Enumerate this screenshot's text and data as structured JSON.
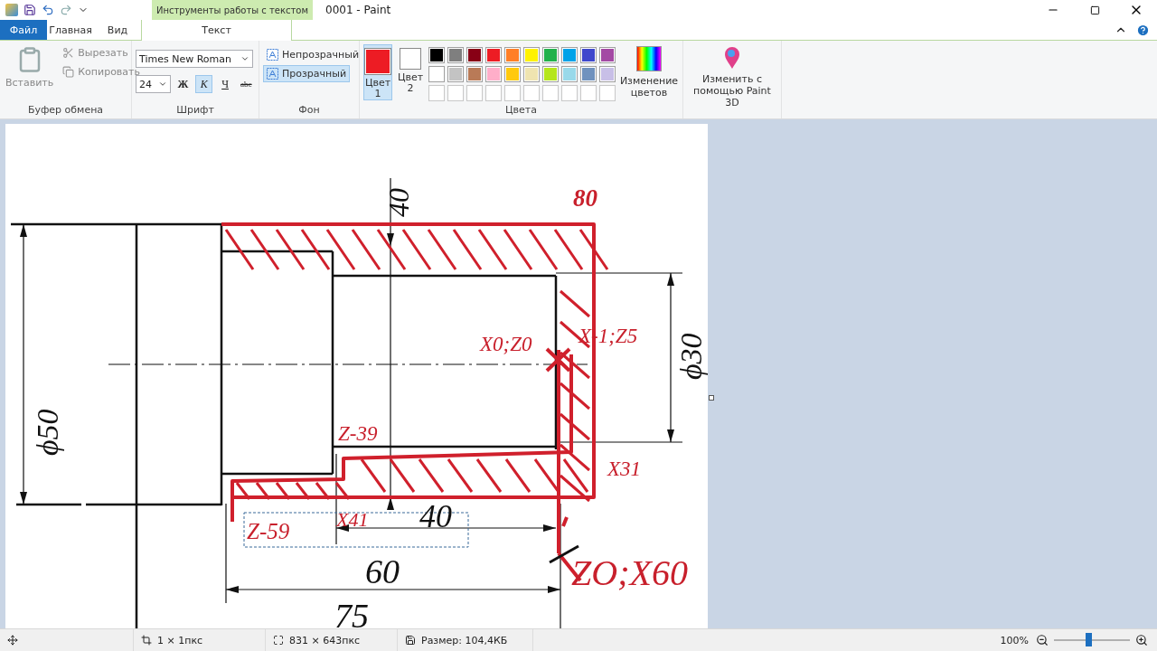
{
  "window": {
    "title": "0001 - Paint",
    "context_group": "Инструменты работы с текстом"
  },
  "tabs": [
    {
      "label": "Файл",
      "kind": "file",
      "selected": false
    },
    {
      "label": "Главная",
      "kind": "tab",
      "selected": false
    },
    {
      "label": "Вид",
      "kind": "tab",
      "selected": false
    },
    {
      "label": "Текст",
      "kind": "context",
      "selected": true
    }
  ],
  "clipboard": {
    "label": "Буфер обмена",
    "paste": {
      "label": "Вставить",
      "disabled": true
    },
    "items": [
      {
        "label": "Вырезать",
        "kind": "cut",
        "disabled": true
      },
      {
        "label": "Копировать",
        "kind": "copy",
        "disabled": true
      }
    ]
  },
  "font": {
    "label": "Шрифт",
    "family": "Times New Roman",
    "size": "24",
    "styles": [
      {
        "label": "Ж",
        "kind": "bold",
        "selected": false
      },
      {
        "label": "К",
        "kind": "italic",
        "selected": true
      },
      {
        "label": "Ч",
        "kind": "underline",
        "selected": false
      },
      {
        "label": "abc",
        "kind": "strike",
        "selected": false
      }
    ]
  },
  "background": {
    "label": "Фон",
    "options": [
      {
        "label": "Непрозрачный",
        "selected": false
      },
      {
        "label": "Прозрачный",
        "selected": true
      }
    ]
  },
  "colors": {
    "label": "Цвета",
    "slots": [
      {
        "label": "Цвет",
        "number": "1",
        "color": "#ed1c24",
        "selected": true
      },
      {
        "label": "Цвет",
        "number": "2",
        "color": "#ffffff",
        "selected": false
      }
    ],
    "palette": [
      {
        "color": "#000000"
      },
      {
        "color": "#7f7f7f"
      },
      {
        "color": "#880015"
      },
      {
        "color": "#ed1c24"
      },
      {
        "color": "#ff7f27"
      },
      {
        "color": "#fff200"
      },
      {
        "color": "#22b14c"
      },
      {
        "color": "#00a2e8"
      },
      {
        "color": "#3f48cc"
      },
      {
        "color": "#a349a4"
      },
      {
        "color": "#ffffff"
      },
      {
        "color": "#c3c3c3"
      },
      {
        "color": "#b97a57"
      },
      {
        "color": "#ffaec9"
      },
      {
        "color": "#ffc90e"
      },
      {
        "color": "#efe4b0"
      },
      {
        "color": "#b5e61d"
      },
      {
        "color": "#99d9ea"
      },
      {
        "color": "#7092be"
      },
      {
        "color": "#c8bfe7"
      }
    ],
    "edit": "Изменение цветов"
  },
  "paint3d": "Изменить с помощью Paint 3D",
  "canvas": {
    "labels": [
      {
        "text": "40",
        "color": "#111111"
      },
      {
        "text": "80",
        "color": "#c8202c"
      },
      {
        "text": "X0;Z0",
        "color": "#c8202c"
      },
      {
        "text": "X-1;Z5",
        "color": "#c8202c"
      },
      {
        "text": "ϕ30",
        "color": "#111111"
      },
      {
        "text": "ϕ50",
        "color": "#111111"
      },
      {
        "text": "Z-39",
        "color": "#c8202c"
      },
      {
        "text": "X31",
        "color": "#c8202c"
      },
      {
        "text": "Z-59",
        "color": "#c8202c"
      },
      {
        "text": "X41",
        "color": "#c8202c"
      },
      {
        "text": "40",
        "color": "#111111"
      },
      {
        "text": "60",
        "color": "#111111"
      },
      {
        "text": "ZO;X60",
        "color": "#c8202c"
      },
      {
        "text": "75",
        "color": "#111111"
      }
    ]
  },
  "status_bar": {
    "selection": "1 × 1пкс",
    "image_size": "831 × 643пкс",
    "file_size": "Размер: 104,4КБ",
    "zoom": "100%",
    "zoom_slider": {
      "level": 0.45
    }
  }
}
